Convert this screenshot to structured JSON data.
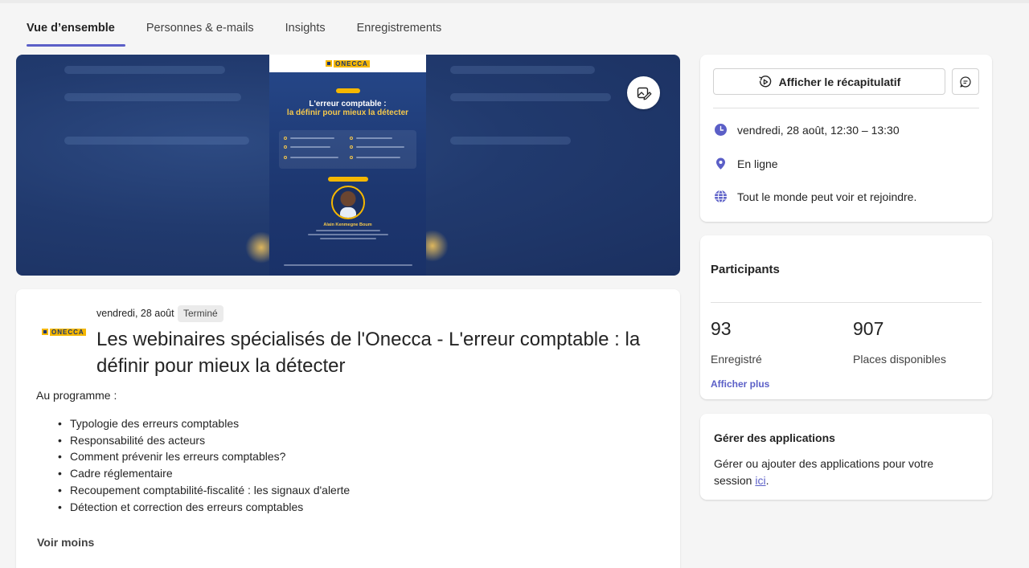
{
  "tabs": [
    {
      "label": "Vue d’ensemble",
      "active": true
    },
    {
      "label": "Personnes & e-mails",
      "active": false
    },
    {
      "label": "Insights",
      "active": false
    },
    {
      "label": "Enregistrements",
      "active": false
    }
  ],
  "banner": {
    "edit_icon": "edit-image-icon",
    "poster": {
      "logo_text": "ONECCA",
      "title_line1": "L'erreur comptable :",
      "title_line2": "la définir pour mieux la détecter",
      "speaker_name": "Alain Kenmegne Boum"
    }
  },
  "event": {
    "logo_text": "ONECCA",
    "date": "vendredi, 28 août",
    "status": "Terminé",
    "title": "Les webinaires spécialisés de l'Onecca - L'erreur comptable : la définir pour mieux la détecter",
    "program_label": "Au programme :",
    "program_items": [
      "Typologie des erreurs comptables",
      "Responsabilité des acteurs",
      "Comment prévenir les erreurs comptables?",
      "Cadre réglementaire",
      "Recoupement comptabilité-fiscalité : les signaux d'alerte",
      "Détection et correction des erreurs comptables"
    ],
    "see_less": "Voir moins"
  },
  "info_card": {
    "recap_label": "Afficher le récapitulatif",
    "schedule": "vendredi, 28 août, 12:30 – 13:30",
    "location": "En ligne",
    "visibility": "Tout le monde peut voir et rejoindre."
  },
  "participants": {
    "title": "Participants",
    "registered_count": "93",
    "registered_label": "Enregistré",
    "available_count": "907",
    "available_label": "Places disponibles",
    "see_more": "Afficher plus"
  },
  "apps": {
    "title": "Gérer des applications",
    "text": "Gérer ou ajouter des applications pour votre session ",
    "link": "ici",
    "suffix": "."
  },
  "colors": {
    "accent": "#5b5fc7",
    "banner_bg": "#213a6e",
    "brand_yellow": "#f5b700"
  }
}
